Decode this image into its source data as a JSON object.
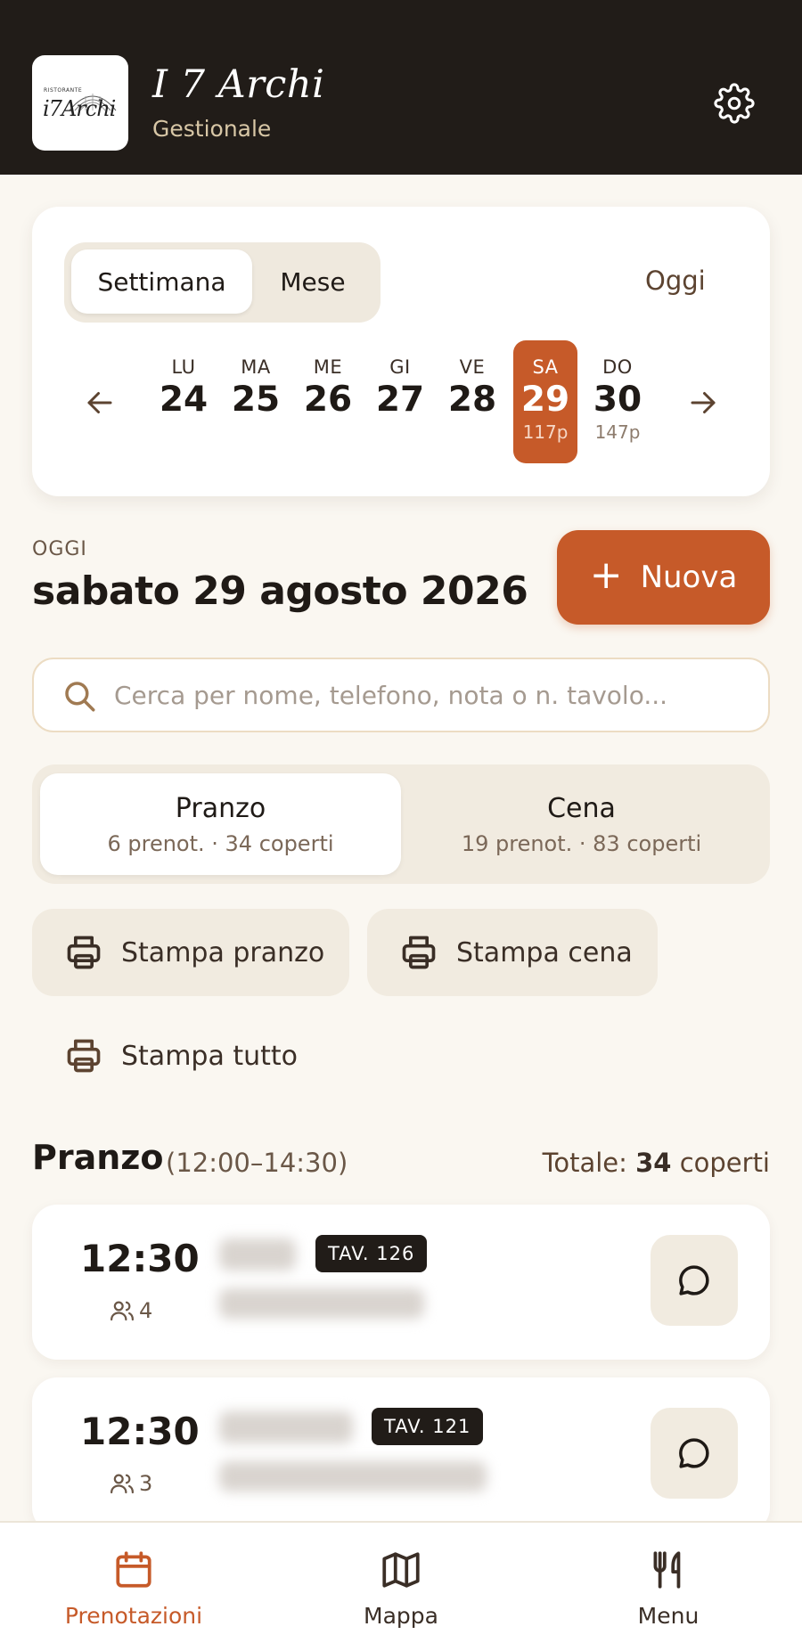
{
  "header": {
    "logo_text": "i7Archi",
    "logo_small": "RISTORANTE",
    "title": "I 7 Archi",
    "subtitle": "Gestionale",
    "settings_icon": "gear-icon"
  },
  "calendar": {
    "view_week": "Settimana",
    "view_month": "Mese",
    "selected_view": "Settimana",
    "today_label": "Oggi",
    "days": [
      {
        "name": "LU",
        "date": "24",
        "covers": ""
      },
      {
        "name": "MA",
        "date": "25",
        "covers": ""
      },
      {
        "name": "ME",
        "date": "26",
        "covers": ""
      },
      {
        "name": "GI",
        "date": "27",
        "covers": ""
      },
      {
        "name": "VE",
        "date": "28",
        "covers": ""
      },
      {
        "name": "SA",
        "date": "29",
        "covers": "117p"
      },
      {
        "name": "DO",
        "date": "30",
        "covers": "147p"
      }
    ],
    "selected_day": "29"
  },
  "date_header": {
    "label": "OGGI",
    "date": "sabato 29 agosto 2026"
  },
  "new_button": {
    "icon": "plus-icon",
    "label": "Nuova"
  },
  "search": {
    "placeholder": "Cerca per nome, telefono, nota o n. tavolo...",
    "value": ""
  },
  "services": [
    {
      "title": "Pranzo",
      "summary": "6 prenot. · 34 coperti"
    },
    {
      "title": "Cena",
      "summary": "19 prenot. · 83 coperti"
    }
  ],
  "print": {
    "lunch": "Stampa pranzo",
    "dinner": "Stampa cena",
    "all": "Stampa tutto"
  },
  "section": {
    "title": "Pranzo",
    "range": "(12:00–14:30)",
    "total_prefix": "Totale:",
    "total_value": "34",
    "total_suffix": "coperti"
  },
  "reservations": [
    {
      "time": "12:30",
      "people": "4",
      "table": "TAV. 126"
    },
    {
      "time": "12:30",
      "people": "3",
      "table": "TAV. 121"
    }
  ],
  "nav": [
    {
      "label": "Prenotazioni",
      "icon": "calendar-icon",
      "active": true
    },
    {
      "label": "Mappa",
      "icon": "map-icon",
      "active": false
    },
    {
      "label": "Menu",
      "icon": "utensils-icon",
      "active": false
    }
  ],
  "colors": {
    "accent": "#c65a29",
    "header_bg": "#211c18",
    "page_bg": "#faf7f1"
  }
}
